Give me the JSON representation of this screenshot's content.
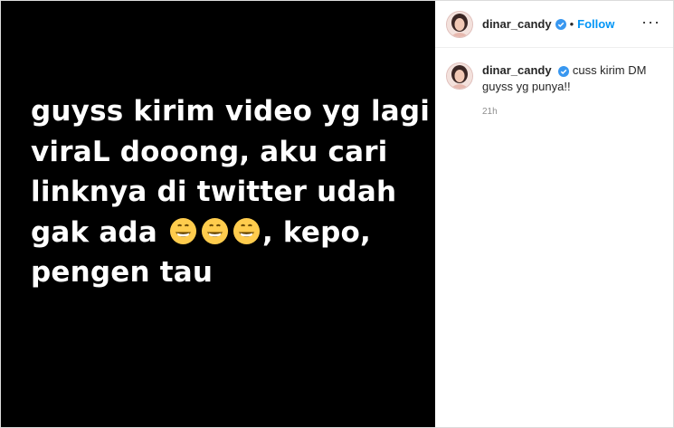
{
  "post": {
    "media_text_lines": [
      "guyss kirim video yg lagi",
      "viraL dooong, aku cari",
      "linknya di twitter udah",
      "gak ada",
      ", kepo,",
      "pengen tau"
    ],
    "emoji": "grinning-face-with-smiling-eyes-icon"
  },
  "header": {
    "username": "dinar_candy",
    "separator": "•",
    "follow_label": "Follow",
    "more_label": "···"
  },
  "caption": {
    "username": "dinar_candy",
    "text": "cuss kirim DM guyss yg punya!!",
    "time": "21h"
  },
  "colors": {
    "link_blue": "#0095f6",
    "verified_blue": "#3897f0",
    "media_bg": "#000000"
  }
}
